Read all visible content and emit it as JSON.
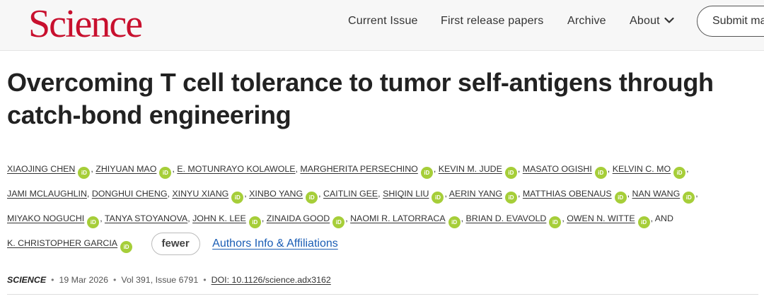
{
  "header": {
    "logo": "Science",
    "nav": {
      "current_issue": "Current Issue",
      "first_release": "First release papers",
      "archive": "Archive",
      "about": "About",
      "submit": "Submit ma"
    }
  },
  "article": {
    "title": "Overcoming T cell tolerance to tumor self-antigens through catch-bond engineering",
    "authors": [
      "XIAOJING CHEN",
      "ZHIYUAN MAO",
      "E. MOTUNRAYO KOLAWOLE",
      "MARGHERITA PERSECHINO",
      "KEVIN M. JUDE",
      "MASATO OGISHI",
      "KELVIN C. MO",
      "JAMI MCLAUGHLIN",
      "DONGHUI CHENG",
      "XINYU XIANG",
      "XINBO YANG",
      "CAITLIN GEE",
      "SHIQIN LIU",
      "AERIN YANG",
      "MATTHIAS OBENAUS",
      "NAN WANG",
      "MIYAKO NOGUCHI",
      "TANYA STOYANOVA",
      "JOHN K. LEE",
      "ZINAIDA GOOD",
      "NAOMI R. LATORRACA",
      "BRIAN D. EVAVOLD",
      "OWEN N. WITTE",
      "K. CHRISTOPHER GARCIA"
    ],
    "orcid_label": "iD",
    "and_label": ", AND",
    "fewer_label": "fewer",
    "affiliations_label": "Authors Info & Affiliations",
    "meta": {
      "journal": "SCIENCE",
      "date": "19 Mar 2026",
      "volume": "Vol 391, Issue 6791",
      "doi": "DOI: 10.1126/science.adx3162"
    }
  },
  "colors": {
    "logo_red": "#c8102e",
    "orcid_green": "#a6ce39",
    "link_blue": "#1a5db5"
  }
}
